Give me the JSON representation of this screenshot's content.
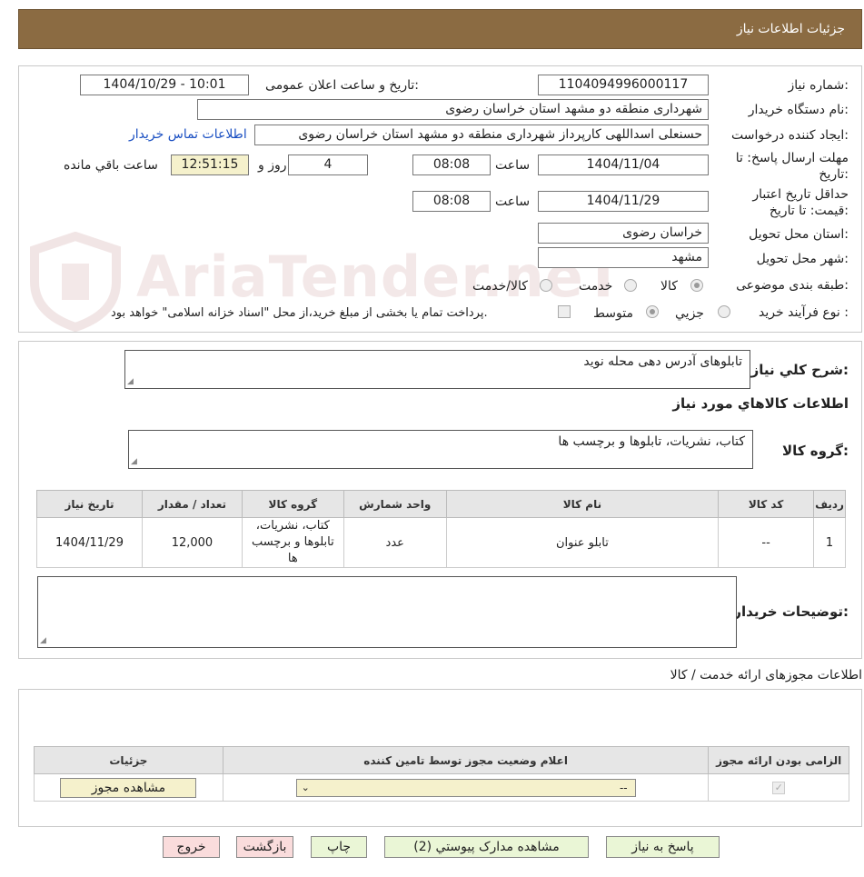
{
  "header": {
    "title": "جزئیات اطلاعات نیاز"
  },
  "watermark": "AriaTender.neT",
  "form": {
    "need_number_label": "شماره نیاز:",
    "need_number": "1104094996000117",
    "announce_label": "تاریخ و ساعت اعلان عمومی:",
    "announce_value": "1404/10/29 - 10:01",
    "buyer_org_label": "نام دستگاه خریدار:",
    "buyer_org": "شهرداری منطقه دو مشهد استان خراسان رضوی",
    "requester_label": "ایجاد کننده درخواست:",
    "requester": "حسنعلی اسداللهی کارپرداز شهرداری منطقه دو مشهد استان خراسان رضوی",
    "contact_link": "اطلاعات تماس خریدار",
    "deadline_label_1": "مهلت ارسال پاسخ: تا",
    "deadline_label_2": "تاریخ:",
    "deadline_date": "1404/11/04",
    "time_label": "ساعت",
    "deadline_time": "08:08",
    "days_value": "4",
    "days_label": "روز و",
    "remaining_time": "12:51:15",
    "remaining_label": "ساعت باقي مانده",
    "validity_label_1": "حداقل تاریخ اعتبار",
    "validity_label_2": "قیمت: تا تاریخ:",
    "validity_date": "1404/11/29",
    "validity_time": "08:08",
    "province_label": "استان محل تحویل:",
    "province": "خراسان رضوی",
    "city_label": "شهر محل تحویل:",
    "city": "مشهد",
    "category_label": "طبقه بندی موضوعی:",
    "category_options": [
      "کالا",
      "خدمت",
      "کالا/خدمت"
    ],
    "purchase_type_label": "نوع فرآیند خرید :",
    "purchase_options": [
      "جزیي",
      "متوسط"
    ],
    "payment_note": "پرداخت تمام یا بخشی از مبلغ خرید،از محل \"اسناد خزانه اسلامی\" خواهد بود."
  },
  "description": {
    "label": "شرح کلي نياز:",
    "value": "تابلوهای آدرس دهی محله نوید"
  },
  "goods": {
    "section_title": "اطلاعات کالاهاي مورد نياز",
    "group_label": "گروه کالا:",
    "group_value": "کتاب، نشریات، تابلوها و برچسب ها",
    "columns": [
      "ردیف",
      "کد کالا",
      "نام کالا",
      "واحد شمارش",
      "گروه کالا",
      "تعداد / مقدار",
      "تاریخ نیاز"
    ],
    "rows": [
      {
        "row": "1",
        "code": "--",
        "name": "تابلو عنوان",
        "unit": "عدد",
        "group": "کتاب، نشریات، تابلوها و برچسب ها",
        "qty": "12,000",
        "date": "1404/11/29"
      }
    ]
  },
  "buyer_notes": {
    "label": "توضیحات خریدار:",
    "value": ""
  },
  "licenses": {
    "title": "اطلاعات مجوزهای ارائه خدمت / کالا",
    "columns": [
      "الزامی بودن ارائه مجوز",
      "اعلام وضعیت مجوز توسط تامین کننده",
      "جزئیات"
    ],
    "select_value": "--",
    "view_button": "مشاهده مجوز"
  },
  "buttons": {
    "reply": "پاسخ به نیاز",
    "attachments": "مشاهده مدارک پیوستي (2)",
    "print": "چاپ",
    "back": "بازگشت",
    "exit": "خروج"
  }
}
